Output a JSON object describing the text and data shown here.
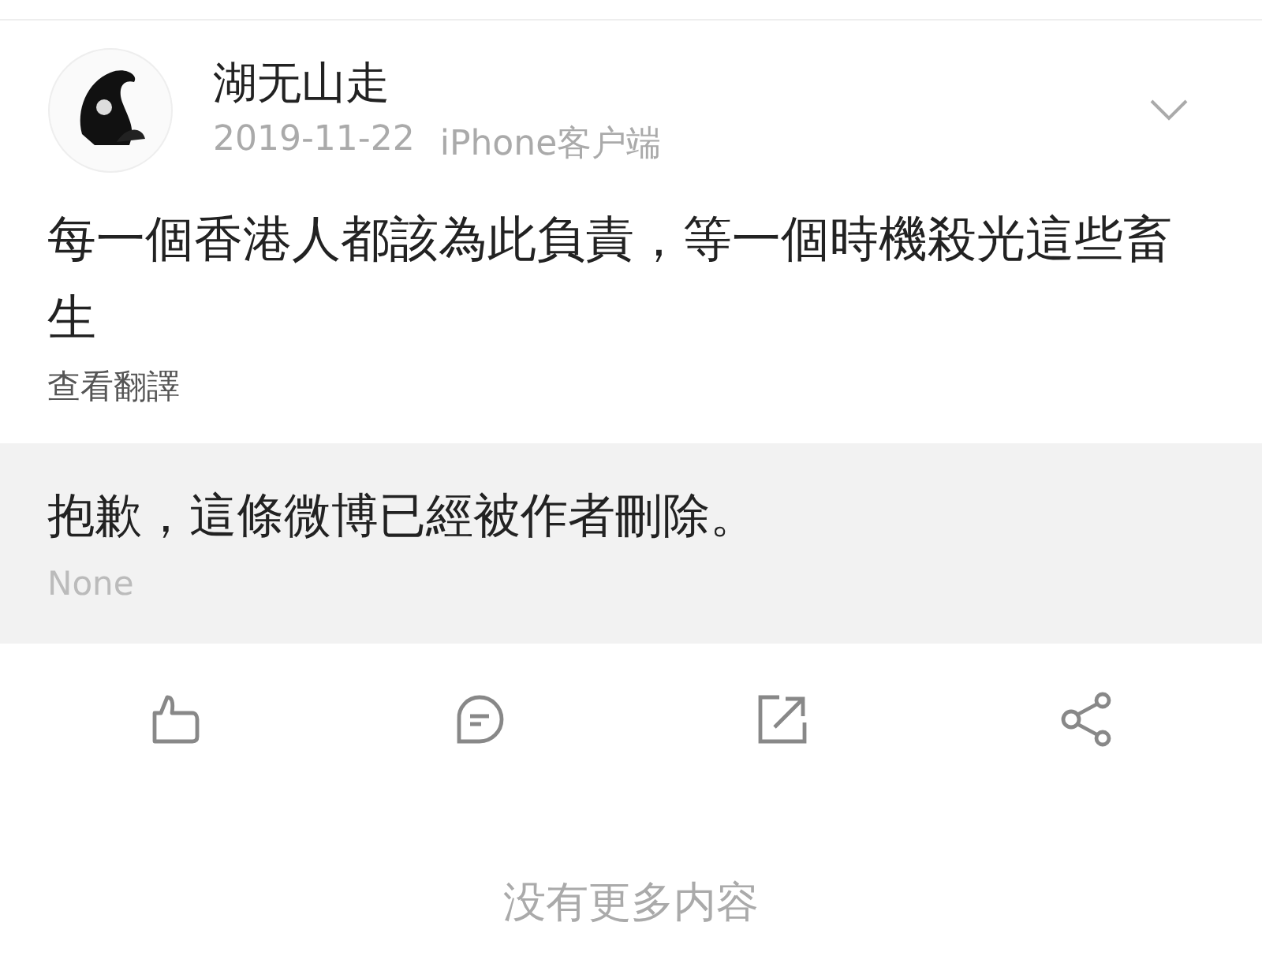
{
  "post": {
    "author": "湖无山走",
    "date": "2019-11-22",
    "source": "iPhone客户端",
    "text": "每一個香港人都該為此負責，等一個時機殺光這些畜生",
    "translate_link": "查看翻譯"
  },
  "retweet": {
    "text": "抱歉，這條微博已經被作者刪除。",
    "note": "None"
  },
  "footer": "没有更多内容"
}
